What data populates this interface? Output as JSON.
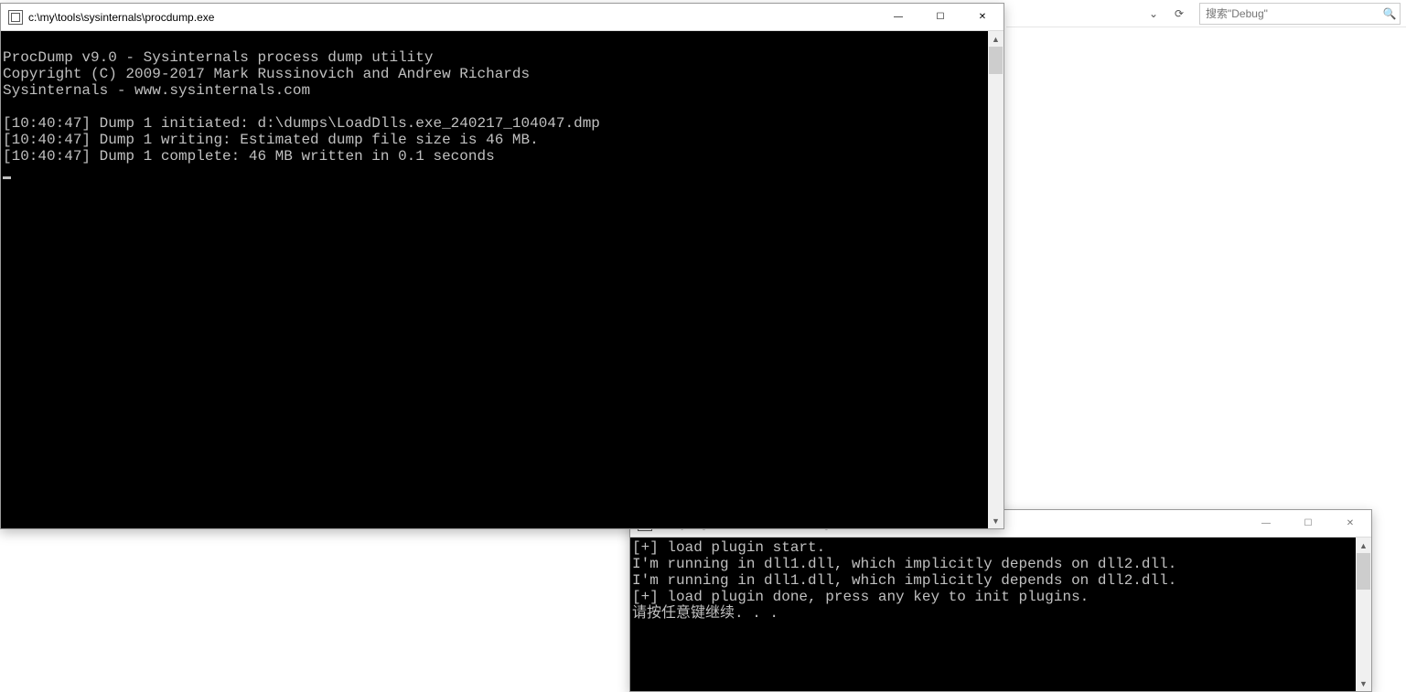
{
  "explorer_bar": {
    "dropdown_glyph": "⌄",
    "refresh_glyph": "⟳",
    "search_placeholder": "搜索\"Debug\"",
    "search_glyph": "🔍"
  },
  "procdump_window": {
    "title": "c:\\my\\tools\\sysinternals\\procdump.exe",
    "buttons": {
      "min": "—",
      "max": "☐",
      "close": "✕"
    },
    "scroll": {
      "up": "▲",
      "down": "▼"
    },
    "lines": [
      "",
      "ProcDump v9.0 - Sysinternals process dump utility",
      "Copyright (C) 2009-2017 Mark Russinovich and Andrew Richards",
      "Sysinternals - www.sysinternals.com",
      "",
      "[10:40:47] Dump 1 initiated: d:\\dumps\\LoadDlls.exe_240217_104047.dmp",
      "[10:40:47] Dump 1 writing: Estimated dump file size is 46 MB.",
      "[10:40:47] Dump 1 complete: 46 MB written in 0.1 seconds"
    ]
  },
  "loaddlls_window": {
    "title": "D:\\myblogstuff\\LoadDlls\\x64\\Debug\\LoadDlls.exe",
    "buttons": {
      "min": "—",
      "max": "☐",
      "close": "✕"
    },
    "scroll": {
      "up": "▲",
      "down": "▼"
    },
    "lines": [
      "[+] load plugin start.",
      "I'm running in dll1.dll, which implicitly depends on dll2.dll.",
      "I'm running in dll1.dll, which implicitly depends on dll2.dll.",
      "[+] load plugin done, press any key to init plugins.",
      "请按任意键继续. . ."
    ]
  }
}
